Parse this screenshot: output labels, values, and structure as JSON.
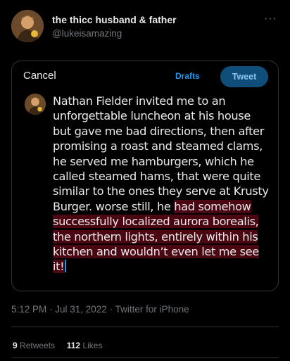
{
  "author": {
    "display_name": "the thicc husband & father",
    "handle": "@lukeisamazing"
  },
  "more_glyph": "···",
  "compose": {
    "cancel_label": "Cancel",
    "drafts_label": "Drafts",
    "tweet_label": "Tweet",
    "lines": [
      "Nathan Fielder invited me to an",
      "unforgettable luncheon at his house",
      "but gave me bad directions, then after",
      "promising a roast and steamed clams,",
      "he served me hamburgers, which he",
      "called steamed hams, that were quite",
      "similar to the ones they serve at Krusty"
    ],
    "line8_plain": "Burger. worse still, he ",
    "line8_selected": "had somehow",
    "selected_lines": [
      "successfully localized aurora borealis,",
      "the northern lights, entirely within his",
      "kitchen and wouldn’t even let me see",
      "it!"
    ]
  },
  "timestamp": "5:12 PM · Jul 31, 2022 · Twitter for iPhone",
  "stats": {
    "retweets_count": "9",
    "retweets_label": "Retweets",
    "likes_count": "112",
    "likes_label": "Likes"
  },
  "colors": {
    "background": "#000000",
    "accent": "#1d9bf0",
    "selection": "#4a0712",
    "muted_text": "#71767b"
  },
  "icons": [
    "avatar-image",
    "more-options-icon"
  ]
}
